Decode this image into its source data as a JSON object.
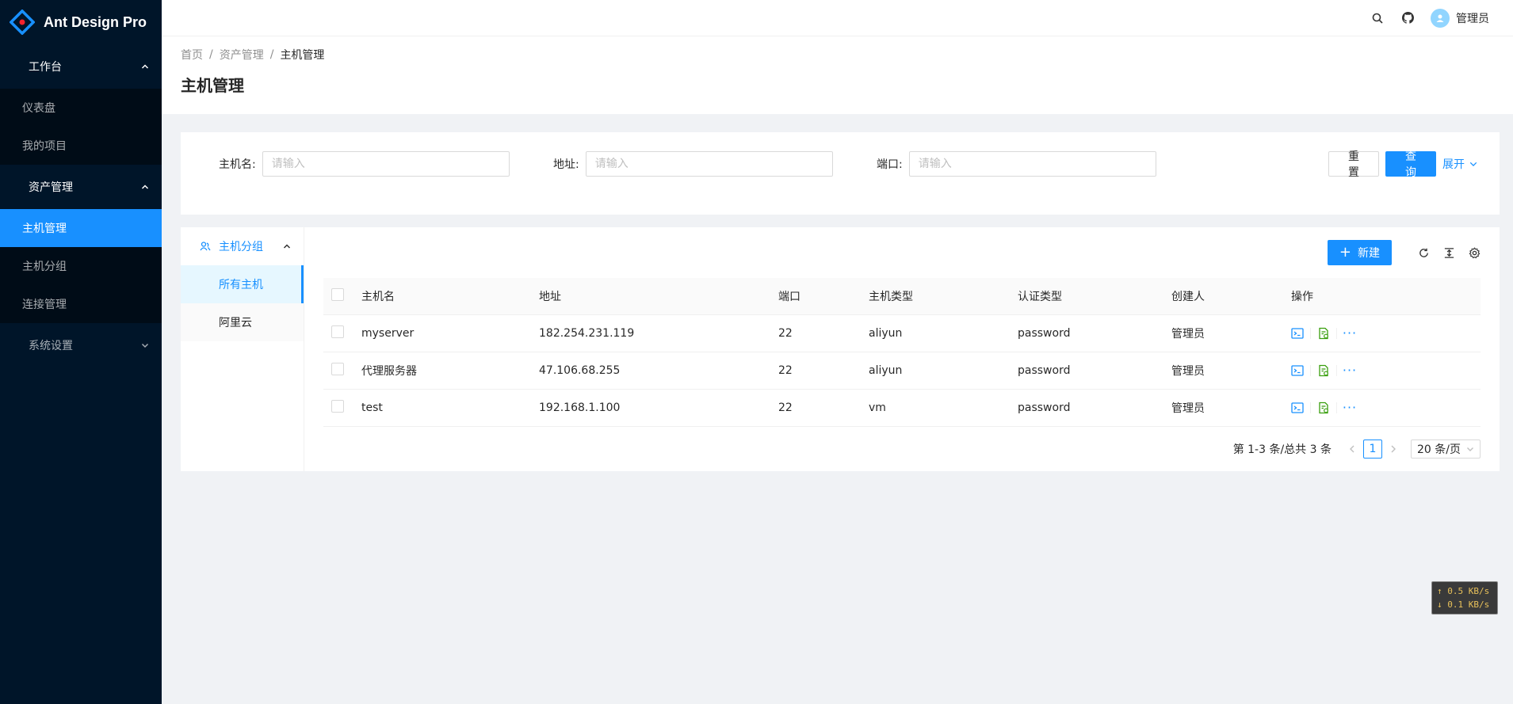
{
  "app": {
    "title": "Ant Design Pro"
  },
  "sidebar": {
    "groups": [
      {
        "label": "工作台",
        "expanded": true,
        "items": [
          "仪表盘",
          "我的项目"
        ]
      },
      {
        "label": "资产管理",
        "expanded": true,
        "items": [
          "主机管理",
          "主机分组",
          "连接管理"
        ]
      },
      {
        "label": "系统设置",
        "expanded": false,
        "items": []
      }
    ],
    "active_item": "主机管理"
  },
  "header": {
    "user_name": "管理员",
    "icons": [
      "search-icon",
      "github-icon"
    ]
  },
  "breadcrumb": [
    "首页",
    "资产管理",
    "主机管理"
  ],
  "page_title": "主机管理",
  "search": {
    "fields": [
      {
        "label": "主机名:",
        "placeholder": "请输入"
      },
      {
        "label": "地址:",
        "placeholder": "请输入"
      },
      {
        "label": "端口:",
        "placeholder": "请输入"
      }
    ],
    "reset_label": "重 置",
    "query_label": "查 询",
    "expand_label": "展开"
  },
  "groups_panel": {
    "title": "主机分组",
    "items": [
      "所有主机",
      "阿里云"
    ],
    "active": "所有主机"
  },
  "toolbar": {
    "new_label": "新建",
    "icons": [
      "reload-icon",
      "column-height-icon",
      "setting-icon"
    ]
  },
  "table": {
    "columns": [
      "主机名",
      "地址",
      "端口",
      "主机类型",
      "认证类型",
      "创建人",
      "操作"
    ],
    "rows": [
      [
        "myserver",
        "182.254.231.119",
        "22",
        "aliyun",
        "password",
        "管理员"
      ],
      [
        "代理服务器",
        "47.106.68.255",
        "22",
        "aliyun",
        "password",
        "管理员"
      ],
      [
        "test",
        "192.168.1.100",
        "22",
        "vm",
        "password",
        "管理员"
      ]
    ],
    "row_actions": [
      "terminal-icon",
      "file-icon",
      "more-icon"
    ]
  },
  "pagination": {
    "total_text": "第 1-3 条/总共 3 条",
    "current_page": "1",
    "page_size": "20 条/页"
  },
  "net_monitor": {
    "up": "↑ 0.5 KB/s",
    "down": "↓ 0.1 KB/s"
  },
  "colors": {
    "primary": "#1890ff",
    "sider_bg": "#001529",
    "submenu_bg": "#000c17"
  }
}
